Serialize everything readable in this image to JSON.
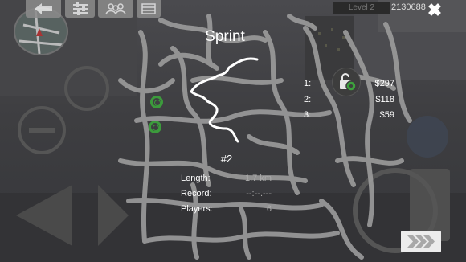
{
  "hud": {
    "level": "Level 2",
    "money": "2130688",
    "close_symbol": "✖"
  },
  "race": {
    "title": "Sprint",
    "number": "#2",
    "rewards": [
      {
        "pos": "1:",
        "amount": "$297"
      },
      {
        "pos": "2:",
        "amount": "$118"
      },
      {
        "pos": "3:",
        "amount": "$59"
      }
    ],
    "stats": {
      "length_label": "Length:",
      "length_value": "1.7 km",
      "record_label": "Record:",
      "record_value": "--:--.---",
      "players_label": "Players:",
      "players_value": "6"
    }
  },
  "icons": {
    "back": "back-arrow-icon",
    "settings": "sliders-icon",
    "players": "players-icon",
    "garage": "garage-icon",
    "lock": "lock-gear-icon",
    "next": "chevrons-right-icon"
  },
  "colors": {
    "route": "#ffffff",
    "marker": "#3c9b3c",
    "map_roads": "#9a9a9a"
  }
}
